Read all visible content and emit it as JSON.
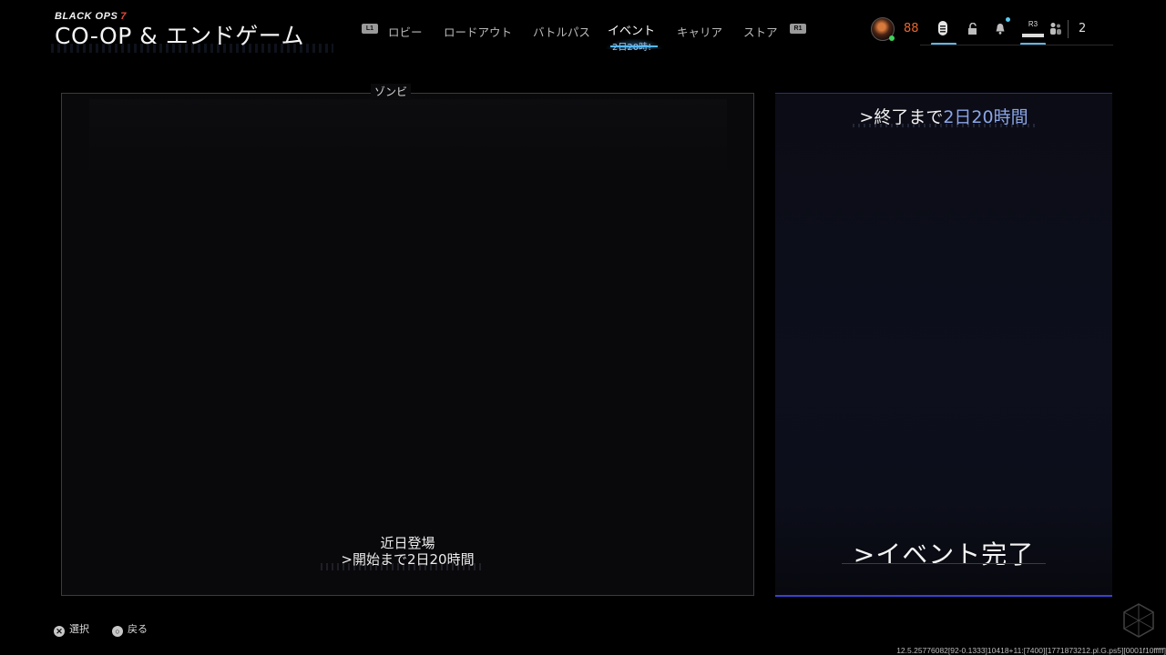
{
  "brand": {
    "game_logo": "BLACK OPS",
    "game_logo_number": "7",
    "mode_title": "CO-OP & エンドゲーム"
  },
  "nav": {
    "left_bumper": "L1",
    "right_bumper": "R1",
    "items": [
      {
        "label": "ロビー"
      },
      {
        "label": "ロードアウト"
      },
      {
        "label": "バトルパス"
      },
      {
        "label": "イベント"
      },
      {
        "label": "キャリア"
      },
      {
        "label": "ストア"
      }
    ],
    "active_index": 3,
    "active_sublabel": "2日20時!"
  },
  "status": {
    "level": "88",
    "r3_label": "R3",
    "party_count": "2",
    "icons": [
      "avatar",
      "challenges-icon",
      "unlock-icon",
      "notification-bell-icon",
      "r3-menu-icon",
      "party-icon"
    ],
    "accent_color": "#58b8ff",
    "level_color": "#e8662e"
  },
  "event_panel": {
    "label": "ゾンビ",
    "status": "近日登場",
    "countdown": ">開始まで2日20時間"
  },
  "side_panel": {
    "end_prefix": ">終了まで",
    "end_time": "2日20時間",
    "complete_label": ">イベント完了",
    "accent_color": "#3942d6",
    "highlight_color": "#8aa6e8"
  },
  "footer": {
    "select_glyph": "✕",
    "select_label": "選択",
    "back_glyph": "○",
    "back_label": "戻る",
    "build_string": "12.5.25776082[92-0.1333]10418+11:[7400][1771873212.pl.G.ps5][0001f10fffff]"
  }
}
